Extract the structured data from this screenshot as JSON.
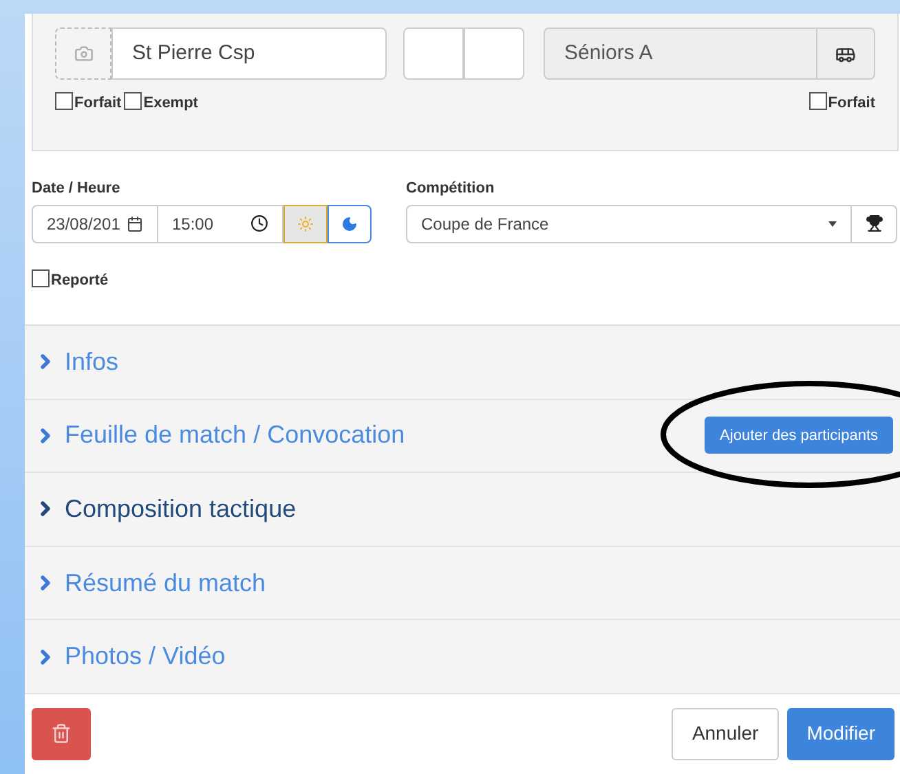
{
  "home_team": {
    "name": "St Pierre Csp",
    "forfait": false,
    "exempt": false,
    "forfait_label": "Forfait",
    "exempt_label": "Exempt"
  },
  "away_team": {
    "name": "Séniors A",
    "forfait": false,
    "forfait_label": "Forfait"
  },
  "date_time": {
    "label": "Date / Heure",
    "date": "23/08/201",
    "time": "15:00",
    "day_mode": [
      {
        "kind": "day",
        "selected": true
      },
      {
        "kind": "night",
        "selected": false
      }
    ]
  },
  "competition": {
    "label": "Compétition",
    "value": "Coupe de France"
  },
  "reporte": {
    "label": "Reporté",
    "checked": false
  },
  "sections": [
    {
      "title": "Infos",
      "selected": false
    },
    {
      "title": "Feuille de match / Convocation",
      "selected": false,
      "action": "Ajouter des participants"
    },
    {
      "title": "Composition tactique",
      "selected": true
    },
    {
      "title": "Résumé du match",
      "selected": false
    },
    {
      "title": "Photos / Vidéo",
      "selected": false
    }
  ],
  "footer": {
    "cancel": "Annuler",
    "submit": "Modifier"
  }
}
